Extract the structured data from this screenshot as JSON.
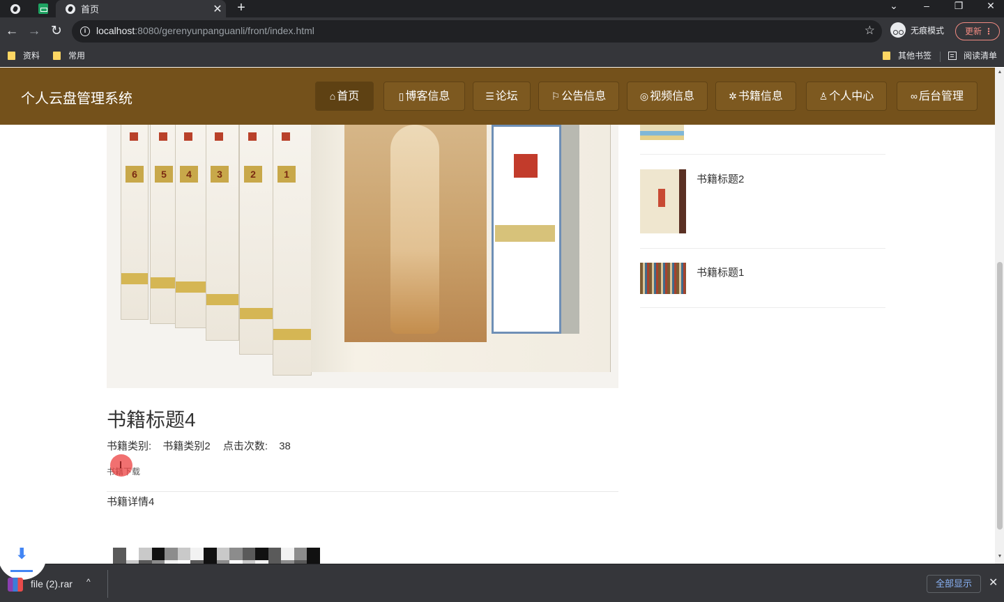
{
  "browser": {
    "tab_title": "首页",
    "tab_close": "✕",
    "new_tab": "+",
    "url_host": "localhost",
    "url_rest": ":8080/gerenyunpanguanli/front/index.html",
    "incognito_label": "无痕模式",
    "update_label": "更新",
    "bookmarks": [
      "资料",
      "常用"
    ],
    "other_bookmarks": "其他书签",
    "reading_list": "阅读清单"
  },
  "site": {
    "title": "个人云盘管理系统",
    "nav": [
      {
        "label": "首页",
        "icon": "home-icon",
        "glyph": "⌂"
      },
      {
        "label": "博客信息",
        "icon": "blog-icon",
        "glyph": "▯"
      },
      {
        "label": "论坛",
        "icon": "forum-icon",
        "glyph": "☰"
      },
      {
        "label": "公告信息",
        "icon": "flag-icon",
        "glyph": "⚐"
      },
      {
        "label": "视频信息",
        "icon": "video-icon",
        "glyph": "◎"
      },
      {
        "label": "书籍信息",
        "icon": "book-icon",
        "glyph": "✲"
      },
      {
        "label": "个人中心",
        "icon": "user-icon",
        "glyph": "♙"
      },
      {
        "label": "后台管理",
        "icon": "link-icon",
        "glyph": "∞"
      }
    ]
  },
  "book": {
    "title": "书籍标题4",
    "category_label": "书籍类别:",
    "category_value": "书籍类别2",
    "clicks_label": "点击次数:",
    "clicks_value": "38",
    "download_label": "书籍下载",
    "detail": "书籍详情4"
  },
  "sidebar": {
    "items": [
      {
        "title": ""
      },
      {
        "title": "书籍标题2"
      },
      {
        "title": "书籍标题1"
      }
    ]
  },
  "downloads": {
    "file_name": "file (2).rar",
    "show_all": "全部显示"
  },
  "colors": {
    "header_brown": "#74511b",
    "active_nav": "#5e4113"
  }
}
